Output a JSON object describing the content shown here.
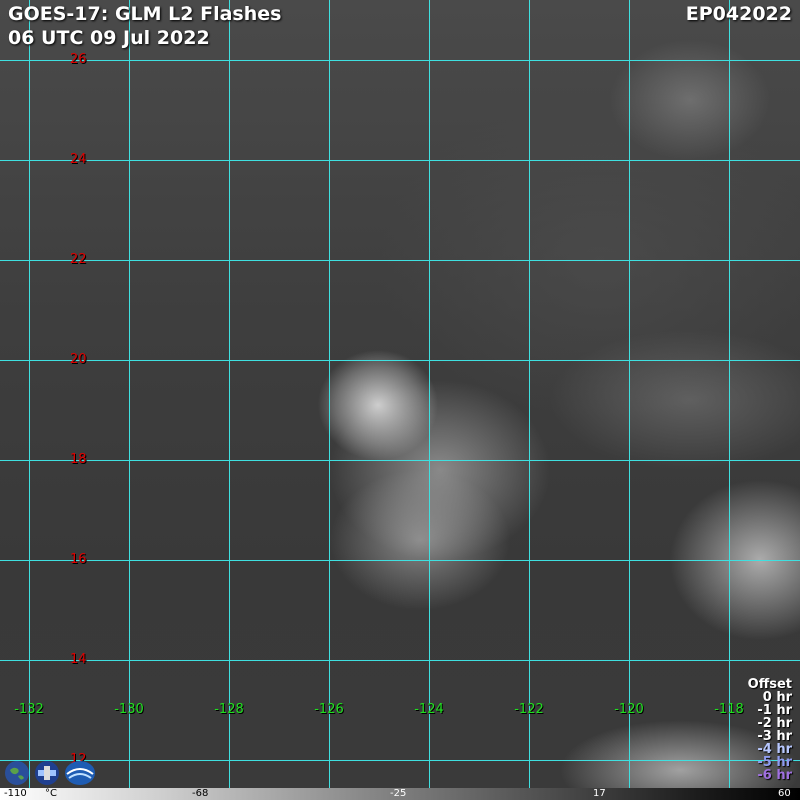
{
  "header": {
    "title_line1": "GOES-17: GLM L2 Flashes",
    "title_line2": "06 UTC 09 Jul 2022",
    "storm_id": "EP042022"
  },
  "grid": {
    "latitudes": [
      "26",
      "24",
      "22",
      "20",
      "18",
      "16",
      "14",
      "12"
    ],
    "longitudes": [
      "-132",
      "-130",
      "-128",
      "-126",
      "-124",
      "-122",
      "-120",
      "-118"
    ]
  },
  "offset_legend": {
    "title": "Offset",
    "items": [
      {
        "label": "0 hr",
        "color": "#ffffff"
      },
      {
        "label": "-1 hr",
        "color": "#ffffff"
      },
      {
        "label": "-2 hr",
        "color": "#ffffff"
      },
      {
        "label": "-3 hr",
        "color": "#ffffff"
      },
      {
        "label": "-4 hr",
        "color": "#b8c8ff"
      },
      {
        "label": "-5 hr",
        "color": "#8f9cf0"
      },
      {
        "label": "-6 hr",
        "color": "#a070e0"
      }
    ]
  },
  "colorbar": {
    "unit": "°C",
    "ticks": [
      "-110",
      "-68",
      "-25",
      "17",
      "60"
    ]
  },
  "logos": [
    "earth-logo",
    "satellite-logo",
    "agency-logo"
  ],
  "colors": {
    "grid": "#3fe0e0",
    "lat_label": "#e00000",
    "lon_label": "#20e020"
  }
}
